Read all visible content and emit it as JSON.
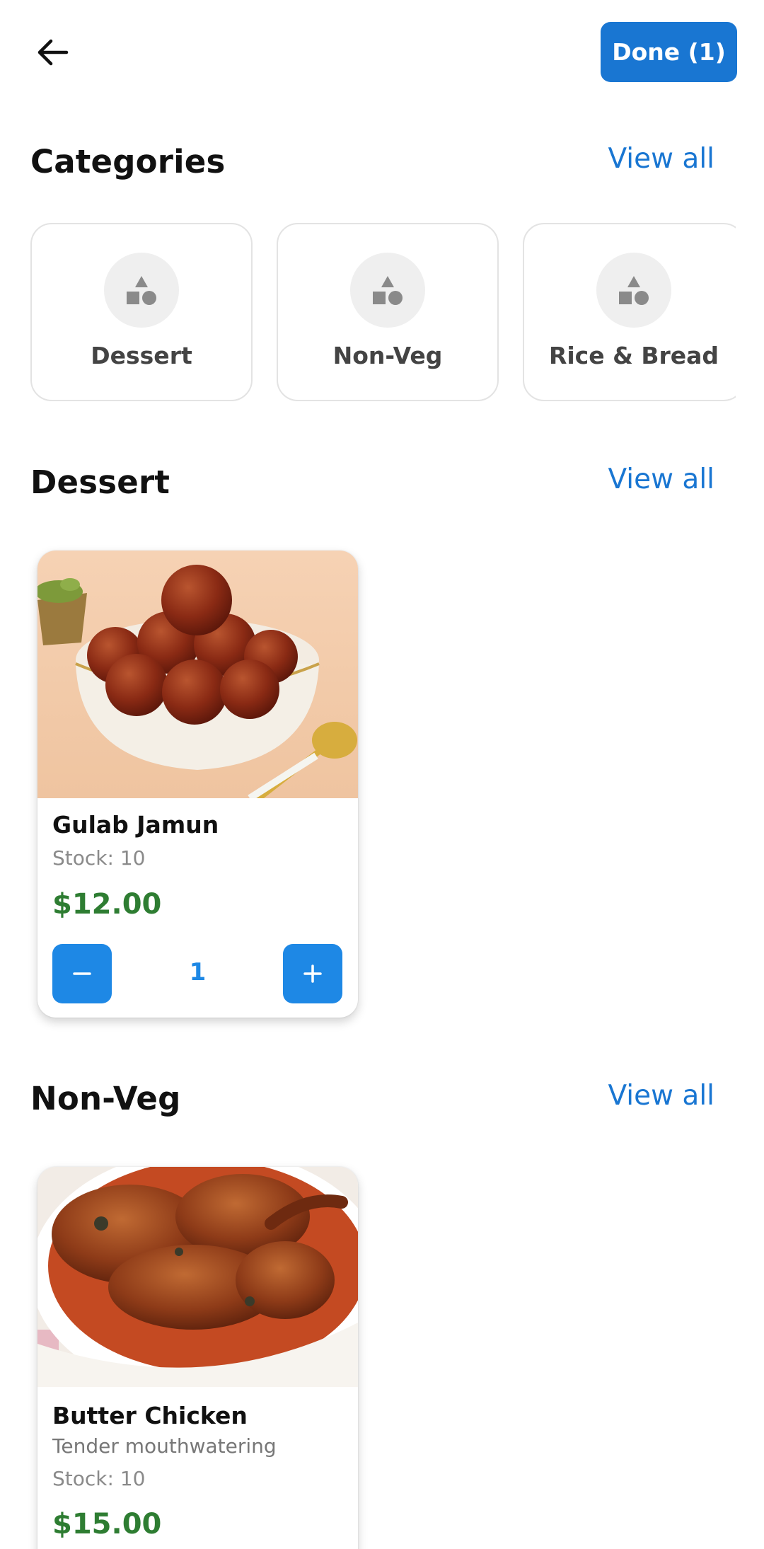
{
  "header": {
    "done_label": "Done (1)"
  },
  "categories_section": {
    "title": "Categories",
    "view_all": "View all",
    "items": [
      {
        "label": "Dessert",
        "icon": "shapes-icon"
      },
      {
        "label": "Non-Veg",
        "icon": "shapes-icon"
      },
      {
        "label": "Rice & Bread",
        "icon": "shapes-icon"
      }
    ]
  },
  "dessert_section": {
    "title": "Dessert",
    "view_all": "View all",
    "products": [
      {
        "name": "Gulab Jamun",
        "stock": "Stock: 10",
        "price": "$12.00",
        "quantity": "1"
      }
    ]
  },
  "nonveg_section": {
    "title": "Non-Veg",
    "view_all": "View all",
    "products": [
      {
        "name": "Butter Chicken",
        "description": "Tender mouthwatering",
        "stock": "Stock: 10",
        "price": "$15.00"
      }
    ]
  },
  "colors": {
    "primary": "#1976d2",
    "price": "#2e7d32",
    "qty_button": "#1e88e5"
  }
}
